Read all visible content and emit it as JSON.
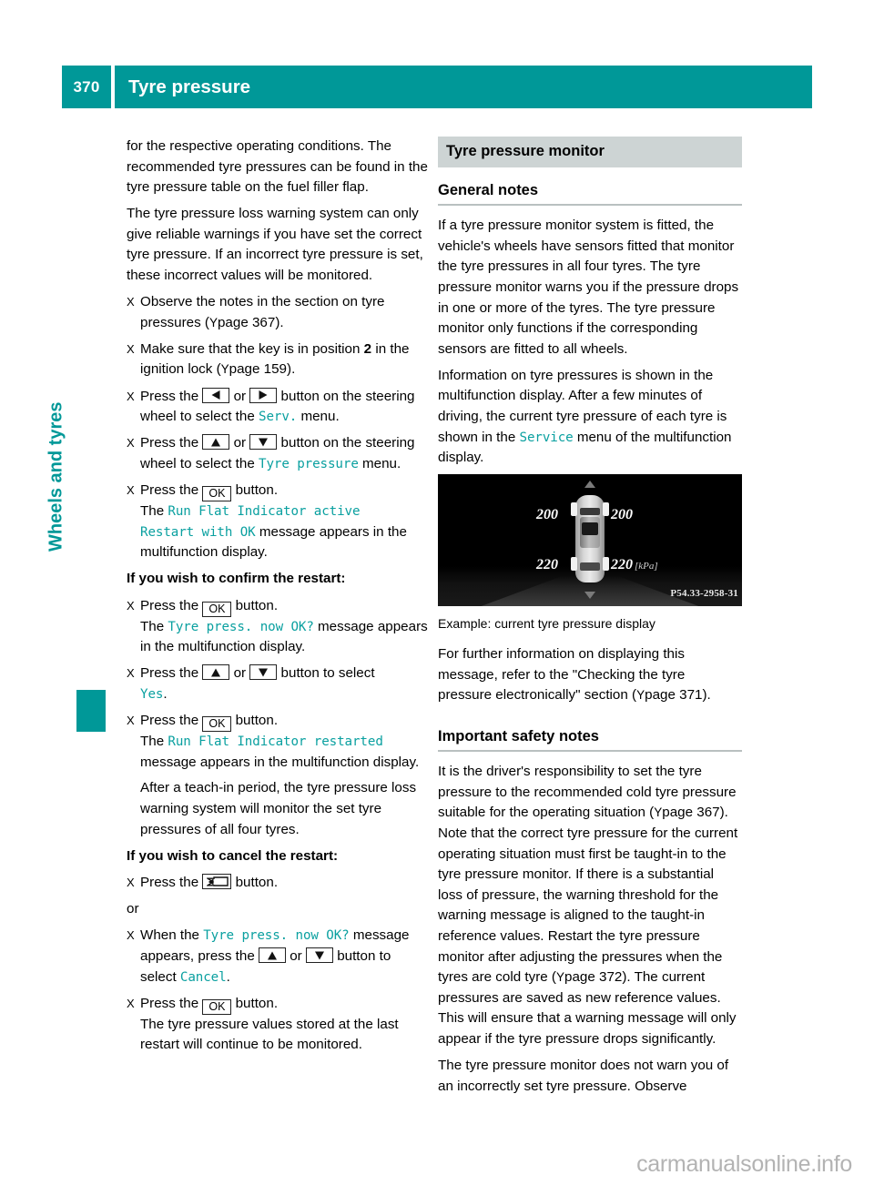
{
  "header": {
    "page_number": "370",
    "title": "Tyre pressure",
    "accent_color": "#009898"
  },
  "side_tab": {
    "label": "Wheels and tyres",
    "color": "#009898"
  },
  "icons": {
    "left_button": "arrow-left-button-icon",
    "right_button": "arrow-right-button-icon",
    "up_button": "arrow-up-button-icon",
    "down_button": "arrow-down-button-icon",
    "ok_button": "ok-button-icon",
    "back_button": "back-button-icon",
    "ok_label": "OK",
    "bullet_marker": "X",
    "pageref_marker": "Y"
  },
  "left_column": {
    "para_1": "for the respective operating conditions. The recommended tyre pressures can be found in the tyre pressure table on the fuel filler flap.",
    "para_2": "The tyre pressure loss warning system can only give reliable warnings if you have set the correct tyre pressure. If an incorrect tyre pressure is set, these incorrect values will be monitored.",
    "bullet_1_a": "Observe the notes in the section on tyre pressures (",
    "bullet_1_page": "page 367",
    "bullet_1_b": ").",
    "bullet_2_a": "Make sure that the key is in position ",
    "bullet_2_bold": "2",
    "bullet_2_b": " in the ignition lock (",
    "bullet_2_page": "page 159",
    "bullet_2_c": ").",
    "bullet_3_a": "Press the ",
    "bullet_3_or": " or ",
    "bullet_3_b": " button on the steering wheel to select the ",
    "bullet_3_code": "Serv.",
    "bullet_3_c": " menu.",
    "bullet_4_a": "Press the ",
    "bullet_4_or": " or ",
    "bullet_4_b": " button on the steering wheel to select the ",
    "bullet_4_code": "Tyre pressure",
    "bullet_4_c": " menu.",
    "bullet_5_a": "Press the ",
    "bullet_5_b": " button.",
    "bullet_5_the": "The ",
    "bullet_5_code_1": "Run Flat Indicator active",
    "bullet_5_code_2": "Restart with OK",
    "bullet_5_c": " message appears in the multifunction display.",
    "heading_confirm": "If you wish to confirm the restart:",
    "bullet_6_a": "Press the ",
    "bullet_6_b": " button.",
    "bullet_6_the": "The ",
    "bullet_6_code": "Tyre press. now OK?",
    "bullet_6_c": " message appears in the multifunction display.",
    "bullet_7_a": "Press the ",
    "bullet_7_or": " or ",
    "bullet_7_b": " button to select ",
    "bullet_7_code": "Yes",
    "bullet_7_c": ".",
    "bullet_8_a": "Press the ",
    "bullet_8_b": " button.",
    "bullet_8_the": "The ",
    "bullet_8_code": "Run Flat Indicator restarted",
    "bullet_8_c": " message appears in the multifunction display.",
    "bullet_8_extra": "After a teach-in period, the tyre pressure loss warning system will monitor the set tyre pressures of all four tyres.",
    "heading_cancel": "If you wish to cancel the restart:",
    "bullet_9_a": "Press the ",
    "bullet_9_b": " button.",
    "or_text": "or",
    "bullet_10_a": "When the ",
    "bullet_10_code": "Tyre press. now OK?",
    "bullet_10_b": " message appears, press the ",
    "bullet_10_or": " or ",
    "bullet_10_c": " button to select ",
    "bullet_10_code2": "Cancel",
    "bullet_10_d": ".",
    "bullet_11_a": "Press the ",
    "bullet_11_b": " button.",
    "bullet_11_extra": "The tyre pressure values stored at the last restart will continue to be monitored."
  },
  "right_column": {
    "section_band": "Tyre pressure monitor",
    "heading_general": "General notes",
    "para_1": "If a tyre pressure monitor system is fitted, the vehicle's wheels have sensors fitted that monitor the tyre pressures in all four tyres. The tyre pressure monitor warns you if the pressure drops in one or more of the tyres. The tyre pressure monitor only functions if the corresponding sensors are fitted to all wheels.",
    "para_2_a": "Information on tyre pressures is shown in the multifunction display. After a few minutes of driving, the current tyre pressure of each tyre is shown in the ",
    "para_2_code": "Service",
    "para_2_b": " menu of the multifunction display.",
    "figure": {
      "pressure_front_left": "200",
      "pressure_front_right": "200",
      "pressure_rear_left": "220",
      "pressure_rear_right": "220",
      "unit": "[kPa]",
      "image_code": "P54.33-2958-31"
    },
    "caption": "Example: current tyre pressure display",
    "para_3_a": "For further information on displaying this message, refer to the \"Checking the tyre pressure electronically\" section (",
    "para_3_page": "page 371",
    "para_3_b": ").",
    "heading_safety": "Important safety notes",
    "para_4_a": "It is the driver's responsibility to set the tyre pressure to the recommended cold tyre pressure suitable for the operating situation (",
    "para_4_page": "page 367",
    "para_4_b": "). Note that the correct tyre pressure for the current operating situation must first be taught-in to the tyre pressure monitor. If there is a substantial loss of pressure, the warning threshold for the warning message is aligned to the taught-in reference values. Restart the tyre pressure monitor after adjusting the pressures when the tyres are cold tyre (",
    "para_4_page2": "page 372",
    "para_4_c": "). The current pressures are saved as new reference values. This will ensure that a warning message will only appear if the tyre pressure drops significantly.",
    "para_5": "The tyre pressure monitor does not warn you of an incorrectly set tyre pressure. Observe"
  },
  "watermark": "carmanualsonline.info"
}
